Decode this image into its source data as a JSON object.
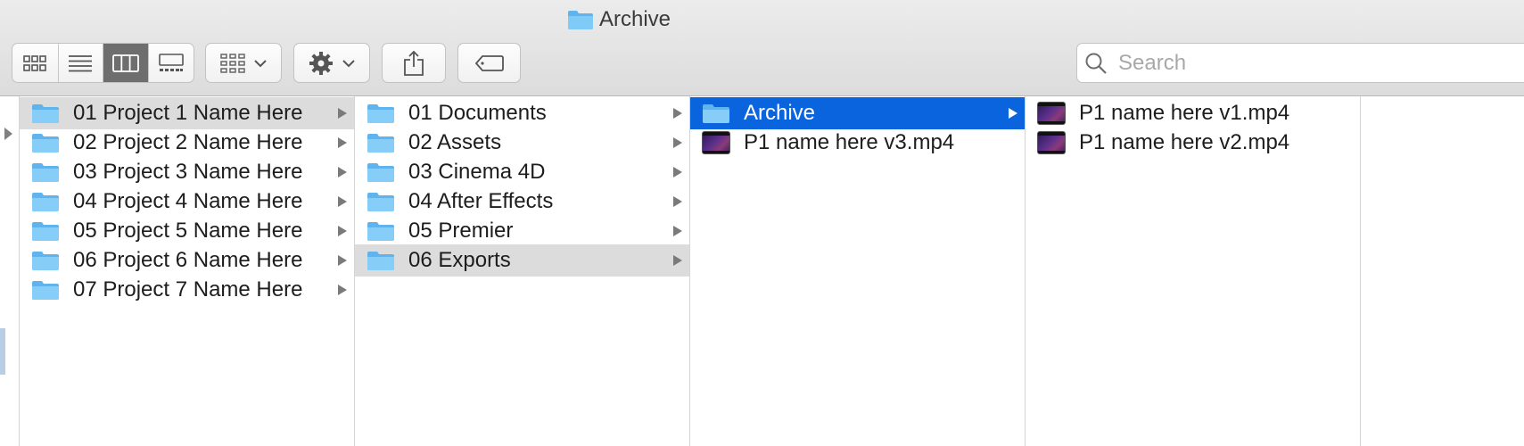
{
  "window": {
    "title": "Archive"
  },
  "toolbar": {
    "view_modes": [
      "icon-view",
      "list-view",
      "column-view",
      "gallery-view"
    ],
    "active_view": "column-view",
    "search_placeholder": "Search"
  },
  "columns": [
    {
      "items": [
        {
          "label": "01 Project 1 Name Here",
          "kind": "folder",
          "state": "highlighted",
          "has_children": true
        },
        {
          "label": "02 Project 2 Name Here",
          "kind": "folder",
          "state": "",
          "has_children": true
        },
        {
          "label": "03 Project 3 Name Here",
          "kind": "folder",
          "state": "",
          "has_children": true
        },
        {
          "label": "04 Project 4 Name Here",
          "kind": "folder",
          "state": "",
          "has_children": true
        },
        {
          "label": "05 Project 5 Name Here",
          "kind": "folder",
          "state": "",
          "has_children": true
        },
        {
          "label": "06 Project 6 Name Here",
          "kind": "folder",
          "state": "",
          "has_children": true
        },
        {
          "label": "07 Project 7 Name Here",
          "kind": "folder",
          "state": "",
          "has_children": true
        }
      ]
    },
    {
      "items": [
        {
          "label": "01 Documents",
          "kind": "folder",
          "state": "",
          "has_children": true
        },
        {
          "label": "02 Assets",
          "kind": "folder",
          "state": "",
          "has_children": true
        },
        {
          "label": "03 Cinema 4D",
          "kind": "folder",
          "state": "",
          "has_children": true
        },
        {
          "label": "04 After Effects",
          "kind": "folder",
          "state": "",
          "has_children": true
        },
        {
          "label": "05 Premier",
          "kind": "folder",
          "state": "",
          "has_children": true
        },
        {
          "label": "06 Exports",
          "kind": "folder",
          "state": "highlighted",
          "has_children": true
        }
      ]
    },
    {
      "items": [
        {
          "label": "Archive",
          "kind": "folder",
          "state": "selected",
          "has_children": true
        },
        {
          "label": "P1 name here v3.mp4",
          "kind": "video",
          "state": "",
          "has_children": false
        }
      ]
    },
    {
      "items": [
        {
          "label": "P1 name here v1.mp4",
          "kind": "video",
          "state": "",
          "has_children": false
        },
        {
          "label": "P1 name here v2.mp4",
          "kind": "video",
          "state": "",
          "has_children": false
        }
      ]
    }
  ],
  "colors": {
    "selection": "#0a64dd",
    "highlight": "#dcdcdc",
    "folder": "#5fb4ee"
  }
}
